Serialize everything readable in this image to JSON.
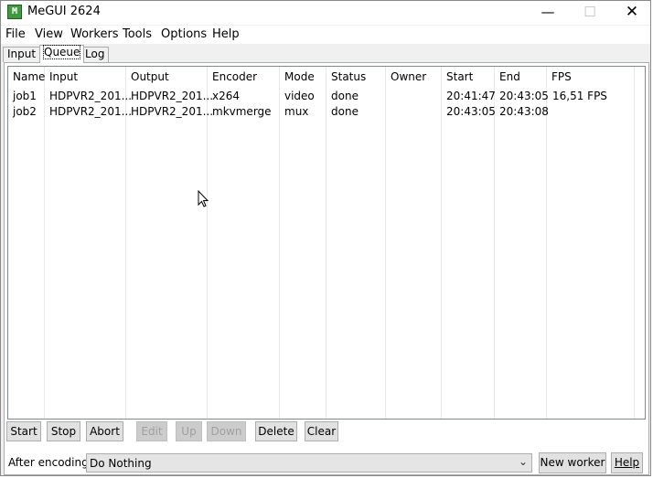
{
  "window": {
    "title": "MeGUI 2624",
    "icon": "megui-app-icon",
    "icon_glyph": "M"
  },
  "menu": [
    "File",
    "View",
    "Workers",
    "Tools",
    "Options",
    "Help"
  ],
  "tabs": [
    {
      "label": "Input",
      "active": false
    },
    {
      "label": "Queue",
      "active": true
    },
    {
      "label": "Log",
      "active": false
    }
  ],
  "queue": {
    "columns": [
      "Name",
      "Input",
      "Output",
      "Encoder",
      "Mode",
      "Status",
      "Owner",
      "Start",
      "End",
      "FPS"
    ],
    "rows": [
      [
        "job1",
        "HDPVR2_201...",
        "HDPVR2_201...",
        "x264",
        "video",
        "done",
        "",
        "20:41:47",
        "20:43:05",
        "16,51 FPS"
      ],
      [
        "job2",
        "HDPVR2_201...",
        "HDPVR2_201...",
        "mkvmerge",
        "mux",
        "done",
        "",
        "20:43:05",
        "20:43:08",
        ""
      ]
    ]
  },
  "buttons": {
    "start": "Start",
    "stop": "Stop",
    "abort": "Abort",
    "edit": "Edit",
    "up": "Up",
    "down": "Down",
    "delete": "Delete",
    "clear": "Clear"
  },
  "after_encoding": {
    "label": "After encoding:",
    "value": "Do Nothing"
  },
  "new_worker": "New worker",
  "help": "Help",
  "colors": {
    "icon_green": "#3f9a3f",
    "disabled_text": "#a0a0a0"
  }
}
